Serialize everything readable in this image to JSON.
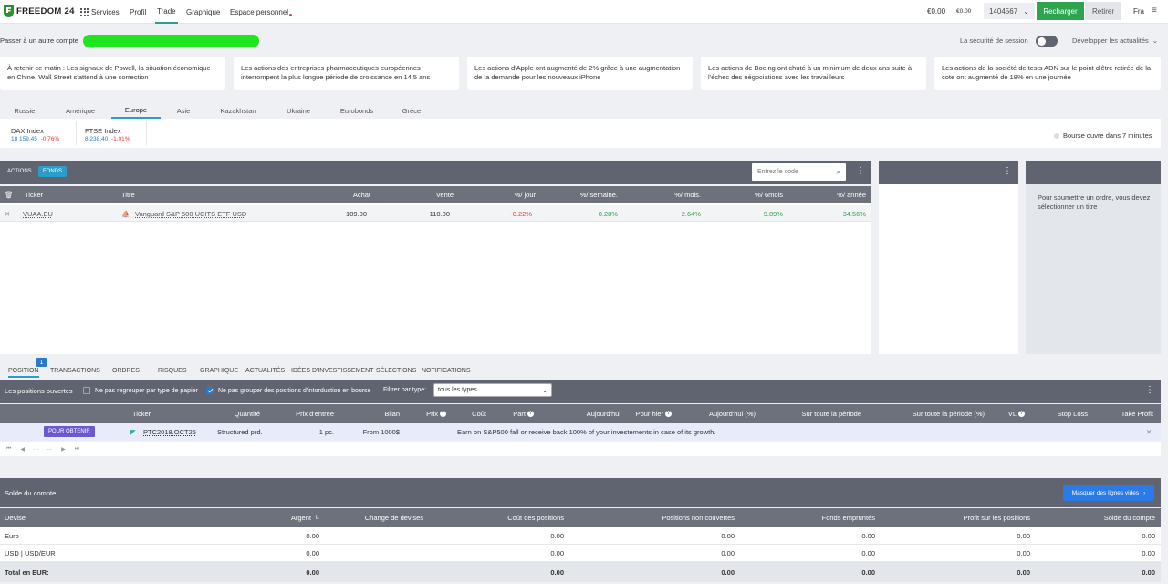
{
  "topbar": {
    "logo_text": "FREEDOM 24",
    "nav": {
      "services": "Services",
      "profil": "Profil",
      "trade": "Trade",
      "graphique": "Graphique",
      "espace": "Espace personnel"
    },
    "balance_main": "€0.00",
    "balance_small": "€0.00",
    "account_number": "1404567",
    "recharge": "Recharger",
    "retirer": "Retirer",
    "language": "Fra"
  },
  "subbar": {
    "switch_label": "Passer à un autre compte",
    "session_label": "La sécurité de session",
    "expand_news": "Développer les actualités"
  },
  "news": [
    "À retenir ce matin : Les signaux de Powell, la situation économique en Chine, Wall Street s'attend à une correction",
    "Les actions des entreprises pharmaceutiques européennes interrompent la plus longue période de croissance en 14,5 ans",
    "Les actions d'Apple ont augmenté de 2% grâce à une augmentation de la demande pour les nouveaux iPhone",
    "Les actions de Boeing ont chuté à un minimum de deux ans suite à l'échec des négociations avec les travailleurs",
    "Les actions de la société de tests ADN sur le point d'être retirée de la cote ont augmenté de 18% en une journée"
  ],
  "market_tabs": [
    "Russie",
    "Amérique",
    "Europe",
    "Asie",
    "Kazakhstan",
    "Ukraine",
    "Eurobonds",
    "Grèce"
  ],
  "indices": [
    {
      "name": "DAX Index",
      "value": "18 159.45",
      "change": "-0.76%"
    },
    {
      "name": "FTSE Index",
      "value": "8 238.40",
      "change": "-1.01%"
    }
  ],
  "market_status": "Bourse ouvre dans 7 minutes",
  "watchlist": {
    "tab_actions": "ACTIONS",
    "tab_fonds": "FONDS",
    "search_placeholder": "Entrez le code",
    "headers": {
      "ticker": "Ticker",
      "titre": "Titre",
      "achat": "Achat",
      "vente": "Vente",
      "jour": "%/ jour",
      "semaine": "%/ semaine.",
      "mois": "%/ mois.",
      "sixmois": "%/ 6mois",
      "annee": "%/ année"
    },
    "row": {
      "ticker": "VUAA.EU",
      "titre": "Vanguard S&P 500 UCITS ETF USD",
      "achat": "109.00",
      "vente": "110.00",
      "jour": "-0.22%",
      "semaine": "0.28%",
      "mois": "2.64%",
      "sixmois": "9.89%",
      "annee": "34.56%"
    }
  },
  "order_panel": {
    "hint": "Pour soumettre un ordre, vous devez sélectionner un titre"
  },
  "bottom_tabs": {
    "position": "POSITION",
    "position_badge": "1",
    "transactions": "TRANSACTIONS",
    "ordres": "ORDRES",
    "risques": "RISQUES",
    "graphique": "GRAPHIQUE",
    "actualites": "ACTUALITÉS",
    "idees": "IDÉES D'INVESTISSEMENT",
    "selections": "SÉLECTIONS",
    "notifications": "NOTIFICATIONS"
  },
  "positions": {
    "title": "Les positions ouvertes",
    "opt1": "Ne pas regrouper par type de papier",
    "opt2": "Ne pas grouper des positions d'intorduction en bourse",
    "filter_label": "Filtrer par type:",
    "filter_value": "tous les types",
    "headers": {
      "ticker": "Ticker",
      "quantite": "Quantité",
      "prix_entree": "Prix d'entrée",
      "bilan": "Bilan",
      "prix": "Prix",
      "cout": "Coût",
      "part": "Part",
      "aujourdhui": "Aujourd'hui",
      "pour_hier": "Pour hier",
      "aujourdhui_pct": "Aujourd'hui (%)",
      "periode": "Sur toute la période",
      "periode_pct": "Sur toute la période (%)",
      "vl": "VL",
      "stop_loss": "Stop Loss",
      "take_profit": "Take Profit"
    },
    "row": {
      "action": "POUR OBTENIR",
      "ticker": "PTC2018.OCT25",
      "type": "Structured prd.",
      "qty": "1 pc.",
      "bilan": "From 1000$",
      "description": "Earn on S&P500 fall or receive back 100% of your investements in case of its growth."
    },
    "pager": [
      "⏮",
      "◀",
      "...",
      "...",
      "▶",
      "⏭"
    ]
  },
  "balance": {
    "title": "Solde du compte",
    "hide_button": "Masquer des lignes vides",
    "headers": {
      "devise": "Devise",
      "argent": "Argent",
      "change": "Change de devises",
      "cout": "Coût des positions",
      "non_couvertes": "Positions non couvertes",
      "fonds": "Fonds empruntés",
      "profit": "Profit sur les positions",
      "solde": "Solde du compte"
    },
    "rows": [
      {
        "devise": "Euro",
        "argent": "0.00",
        "cout": "0.00",
        "non_couvertes": "0.00",
        "fonds": "0.00",
        "profit": "0.00",
        "solde": "0.00"
      },
      {
        "devise": "USD | USD/EUR",
        "argent": "0.00",
        "cout": "0.00",
        "non_couvertes": "0.00",
        "fonds": "0.00",
        "profit": "0.00",
        "solde": "0.00"
      }
    ],
    "total": {
      "devise": "Total en EUR:",
      "argent": "0.00",
      "cout": "0.00",
      "non_couvertes": "0.00",
      "fonds": "0.00",
      "profit": "0.00",
      "solde": "0.00"
    }
  },
  "colors": {
    "accent_green": "#2ea44f",
    "accent_blue": "#2a7ac8",
    "header_dark": "#5f6470",
    "negative": "#e53935",
    "positive": "#2e9e4f"
  }
}
